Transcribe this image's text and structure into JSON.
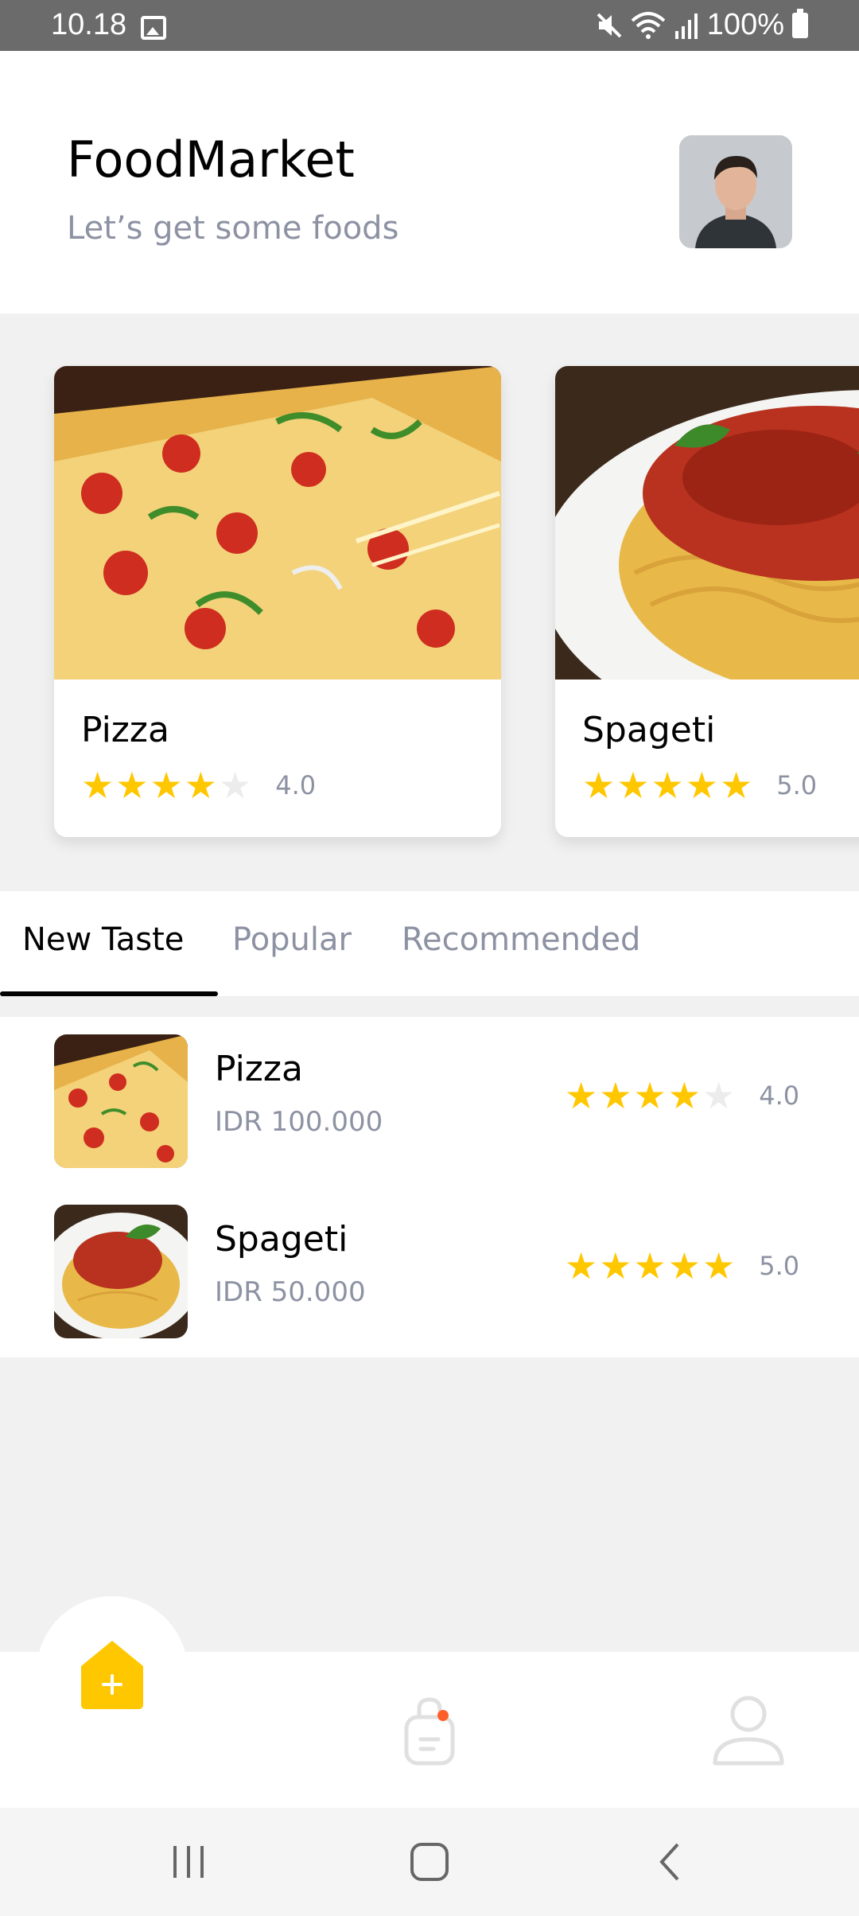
{
  "status_bar": {
    "time": "10.18",
    "battery": "100%",
    "icons": [
      "gallery-icon",
      "mute-icon",
      "wifi-icon",
      "signal-icon",
      "battery-icon"
    ]
  },
  "header": {
    "title": "FoodMarket",
    "subtitle": "Let’s get some foods"
  },
  "featured": [
    {
      "name": "Pizza",
      "rating": 4,
      "rating_text": "4.0"
    },
    {
      "name": "Spageti",
      "rating": 5,
      "rating_text": "5.0"
    }
  ],
  "tabs": [
    {
      "label": "New Taste",
      "active": true
    },
    {
      "label": "Popular",
      "active": false
    },
    {
      "label": "Recommended",
      "active": false
    }
  ],
  "list": [
    {
      "name": "Pizza",
      "price": "IDR 100.000",
      "rating": 4,
      "rating_text": "4.0"
    },
    {
      "name": "Spageti",
      "price": "IDR 50.000",
      "rating": 5,
      "rating_text": "5.0"
    }
  ],
  "bottom_nav": [
    "home-icon",
    "order-bag-icon",
    "profile-icon"
  ],
  "colors": {
    "accent": "#ffc700",
    "muted_text": "#8d92a3",
    "badge": "#fe5f2a"
  }
}
